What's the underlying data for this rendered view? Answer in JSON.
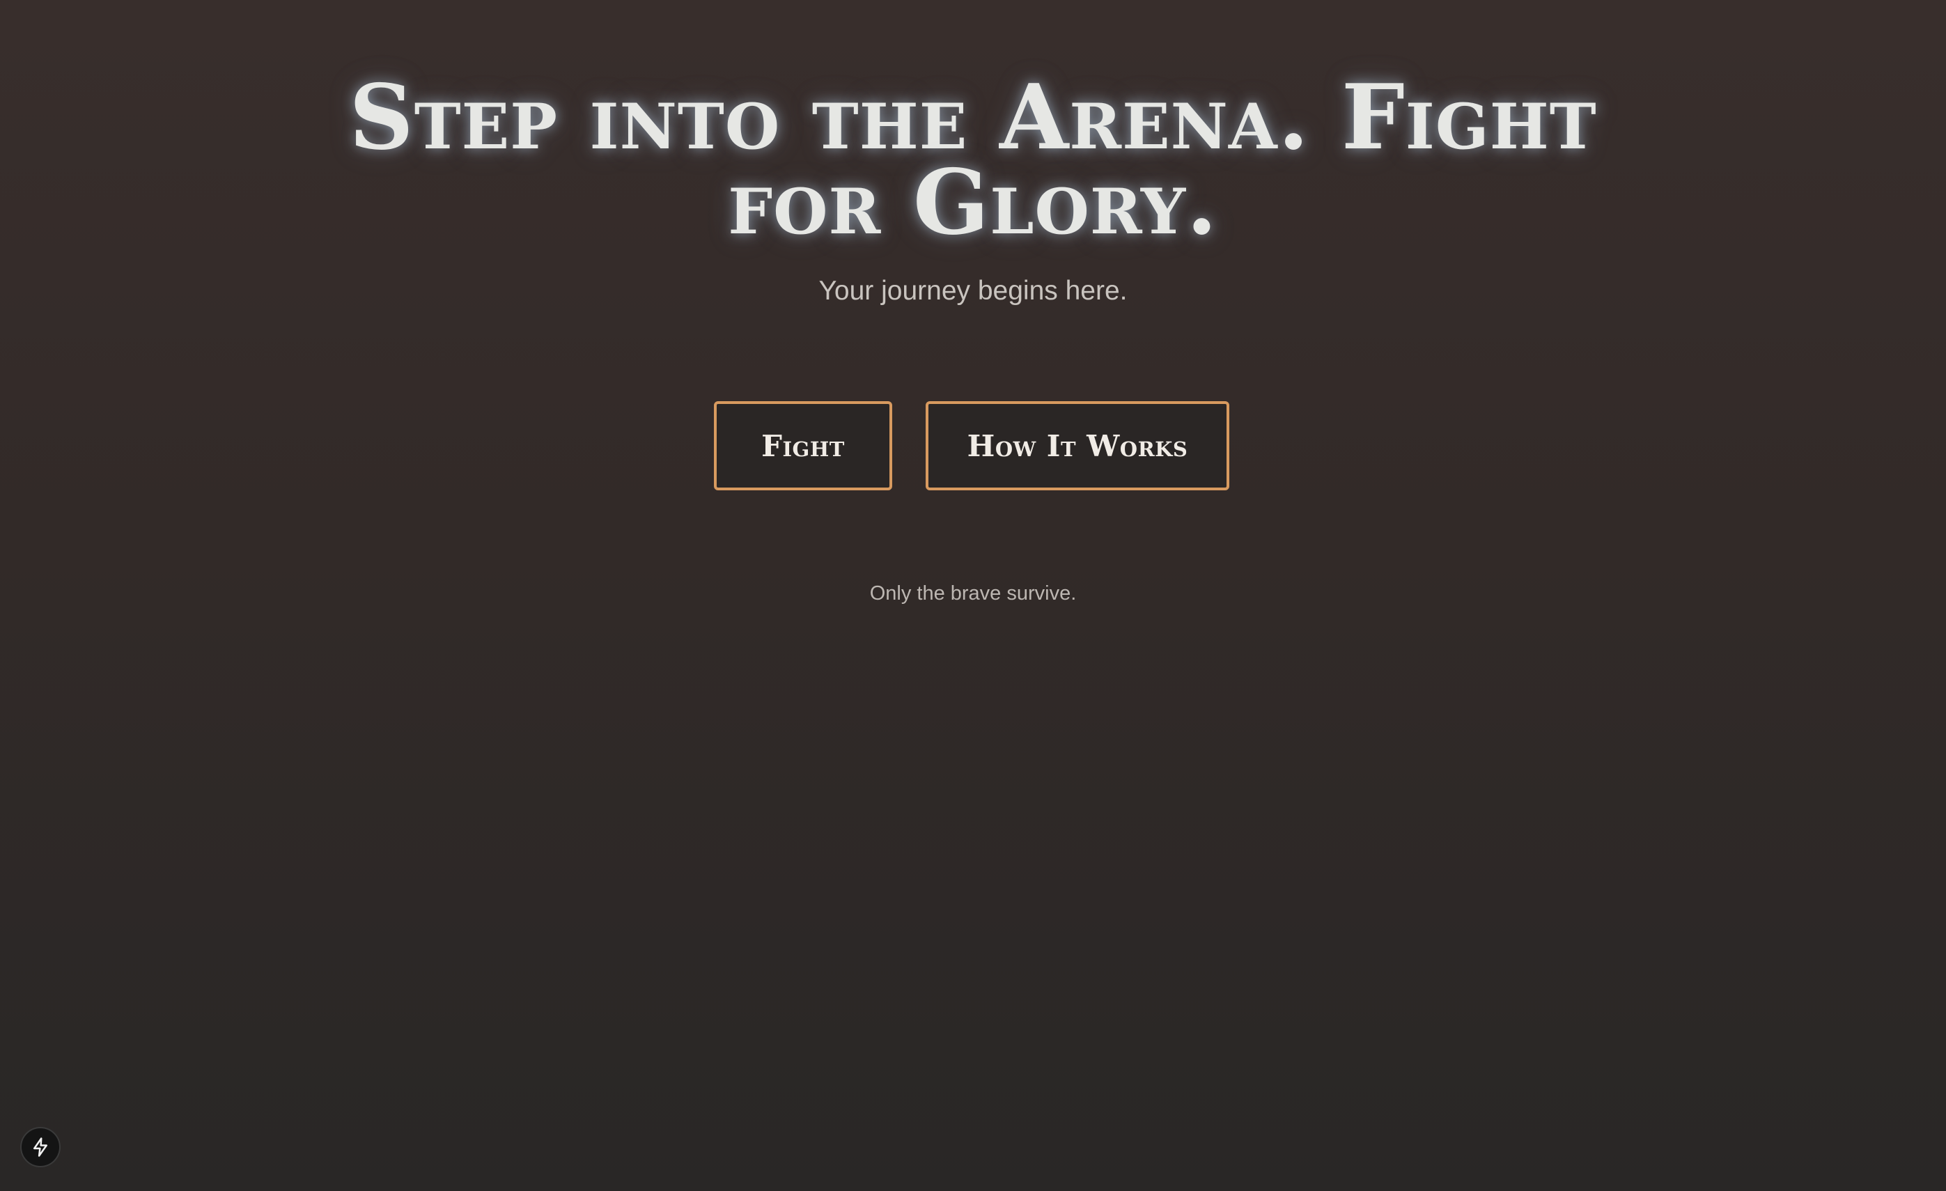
{
  "hero": {
    "title": "Step into the Arena. Fight for Glory.",
    "subtitle": "Your journey begins here."
  },
  "actions": {
    "fight_label": "Fight",
    "how_it_works_label": "How It Works"
  },
  "tagline": "Only the brave survive.",
  "dev_indicator": {
    "icon": "lightning-bolt-icon"
  },
  "colors": {
    "background_top": "#382e2c",
    "background_bottom": "#292726",
    "title_text": "#e6e7e4",
    "button_border": "#d89a5f",
    "button_background": "#2a2625",
    "muted_text": "#c9c4bf"
  }
}
